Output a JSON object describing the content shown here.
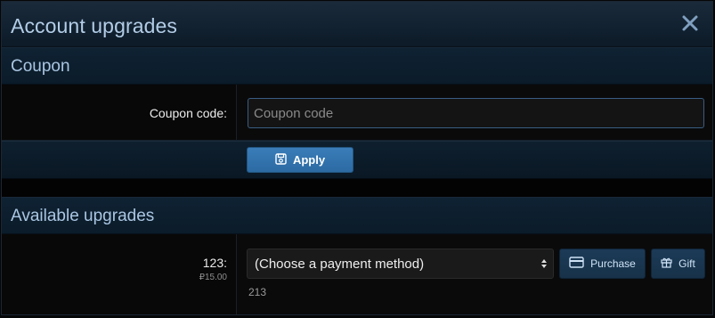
{
  "dialog": {
    "title": "Account upgrades"
  },
  "coupon": {
    "section_title": "Coupon",
    "field_label": "Coupon code:",
    "input_placeholder": "Coupon code",
    "input_value": "",
    "apply_label": "Apply"
  },
  "upgrades": {
    "section_title": "Available upgrades",
    "items": [
      {
        "name": "123:",
        "price": "₽15.00",
        "payment_select": "(Choose a payment method)",
        "purchase_label": "Purchase",
        "gift_label": "Gift",
        "description": "213"
      }
    ]
  },
  "colors": {
    "accent": "#2f73ad",
    "title_text": "#b3cde6",
    "background": "#0b0c0e"
  },
  "icons": [
    "close-icon",
    "save-icon",
    "credit-card-icon",
    "gift-icon",
    "select-arrows-icon"
  ]
}
